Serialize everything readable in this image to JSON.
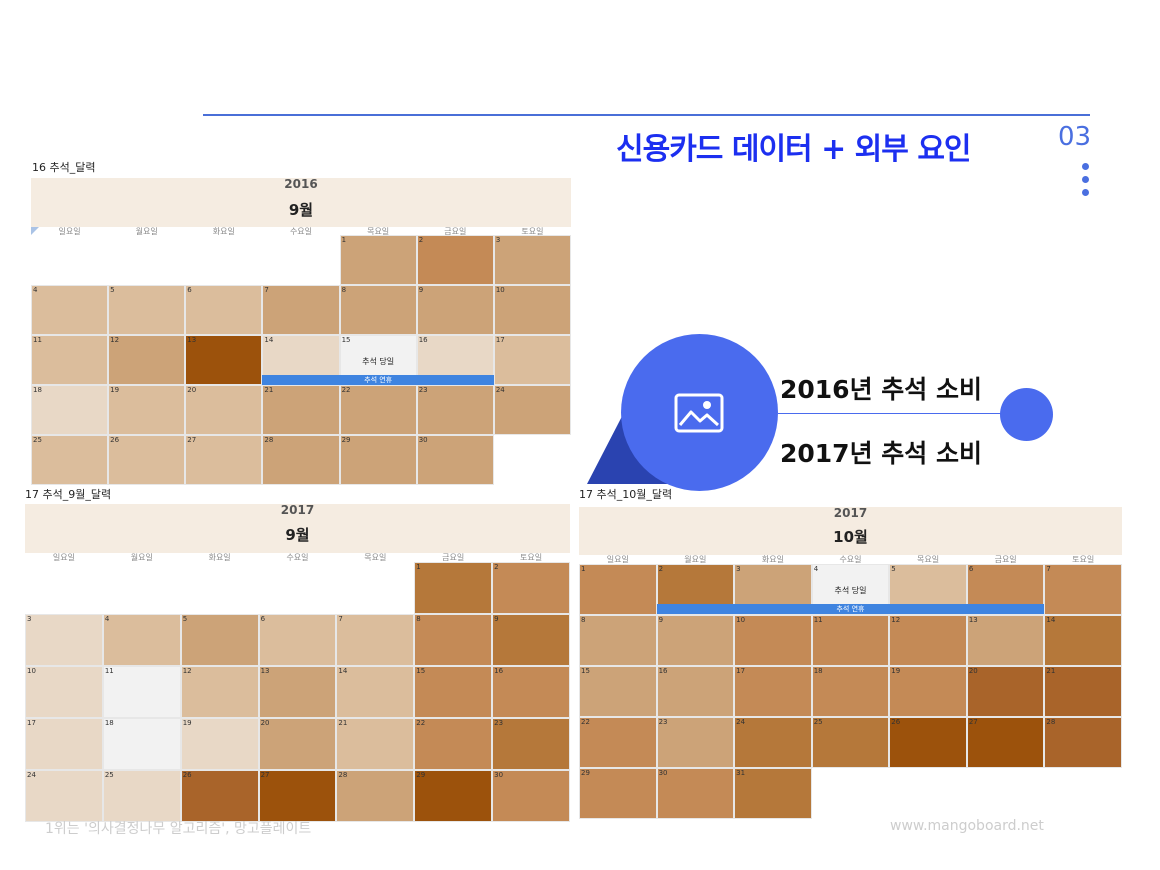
{
  "header": {
    "title": "신용카드 데이터 + 외부 요인",
    "page_number": "03"
  },
  "calendars": [
    {
      "caption": "16 추석_달력",
      "year": "2016",
      "month": "9월",
      "weekdays": [
        "일요일",
        "월요일",
        "화요일",
        "수요일",
        "목요일",
        "금요일",
        "토요일"
      ],
      "weeks": [
        [
          null,
          null,
          null,
          null,
          {
            "d": "1",
            "c": "#cca378"
          },
          {
            "d": "2",
            "c": "#c48a56"
          },
          {
            "d": "3",
            "c": "#cca378"
          }
        ],
        [
          {
            "d": "4",
            "c": "#dbbd9c"
          },
          {
            "d": "5",
            "c": "#dbbd9c"
          },
          {
            "d": "6",
            "c": "#dbbd9c"
          },
          {
            "d": "7",
            "c": "#cca378"
          },
          {
            "d": "8",
            "c": "#cca378"
          },
          {
            "d": "9",
            "c": "#cca378"
          },
          {
            "d": "10",
            "c": "#cca378"
          }
        ],
        [
          {
            "d": "11",
            "c": "#dbbd9c"
          },
          {
            "d": "12",
            "c": "#cca378"
          },
          {
            "d": "13",
            "c": "#9c520c"
          },
          {
            "d": "14",
            "c": "#e8d8c6"
          },
          {
            "d": "15",
            "c": "#f2f2f2",
            "text": "추석 당일"
          },
          {
            "d": "16",
            "c": "#e8d8c6"
          },
          {
            "d": "17",
            "c": "#dbbd9c"
          }
        ],
        [
          {
            "d": "18",
            "c": "#e8d8c6"
          },
          {
            "d": "19",
            "c": "#dbbd9c"
          },
          {
            "d": "20",
            "c": "#dbbd9c"
          },
          {
            "d": "21",
            "c": "#cca378"
          },
          {
            "d": "22",
            "c": "#cca378"
          },
          {
            "d": "23",
            "c": "#cca378"
          },
          {
            "d": "24",
            "c": "#cca378"
          }
        ],
        [
          {
            "d": "25",
            "c": "#dbbd9c"
          },
          {
            "d": "26",
            "c": "#dbbd9c"
          },
          {
            "d": "27",
            "c": "#dbbd9c"
          },
          {
            "d": "28",
            "c": "#cca378"
          },
          {
            "d": "29",
            "c": "#cca378"
          },
          {
            "d": "30",
            "c": "#cca378"
          },
          null
        ]
      ],
      "holiday_bar": {
        "label": "추석 연휴",
        "row": 2
      }
    },
    {
      "caption": "17 추석_9월_달력",
      "year": "2017",
      "month": "9월",
      "weekdays": [
        "일요일",
        "월요일",
        "화요일",
        "수요일",
        "목요일",
        "금요일",
        "토요일"
      ],
      "weeks": [
        [
          null,
          null,
          null,
          null,
          null,
          {
            "d": "1",
            "c": "#b5783a"
          },
          {
            "d": "2",
            "c": "#c48a56"
          }
        ],
        [
          {
            "d": "3",
            "c": "#e8d8c6"
          },
          {
            "d": "4",
            "c": "#dbbd9c"
          },
          {
            "d": "5",
            "c": "#cca378"
          },
          {
            "d": "6",
            "c": "#dbbd9c"
          },
          {
            "d": "7",
            "c": "#dbbd9c"
          },
          {
            "d": "8",
            "c": "#c48a56"
          },
          {
            "d": "9",
            "c": "#b5783a"
          }
        ],
        [
          {
            "d": "10",
            "c": "#e8d8c6"
          },
          {
            "d": "11",
            "c": "#f2f2f2"
          },
          {
            "d": "12",
            "c": "#dbbd9c"
          },
          {
            "d": "13",
            "c": "#cca378"
          },
          {
            "d": "14",
            "c": "#dbbd9c"
          },
          {
            "d": "15",
            "c": "#c48a56"
          },
          {
            "d": "16",
            "c": "#c48a56"
          }
        ],
        [
          {
            "d": "17",
            "c": "#e8d8c6"
          },
          {
            "d": "18",
            "c": "#f2f2f2"
          },
          {
            "d": "19",
            "c": "#e8d8c6"
          },
          {
            "d": "20",
            "c": "#cca378"
          },
          {
            "d": "21",
            "c": "#dbbd9c"
          },
          {
            "d": "22",
            "c": "#c48a56"
          },
          {
            "d": "23",
            "c": "#b5783a"
          }
        ],
        [
          {
            "d": "24",
            "c": "#e8d8c6"
          },
          {
            "d": "25",
            "c": "#e8d8c6"
          },
          {
            "d": "26",
            "c": "#a9642a"
          },
          {
            "d": "27",
            "c": "#9c520c"
          },
          {
            "d": "28",
            "c": "#cca378"
          },
          {
            "d": "29",
            "c": "#9c520c"
          },
          {
            "d": "30",
            "c": "#c48a56"
          }
        ]
      ],
      "holiday_bar": null
    },
    {
      "caption": "17 추석_10월_달력",
      "year": "2017",
      "month": "10월",
      "weekdays": [
        "일요일",
        "월요일",
        "화요일",
        "수요일",
        "목요일",
        "금요일",
        "토요일"
      ],
      "weeks": [
        [
          {
            "d": "1",
            "c": "#c48a56"
          },
          {
            "d": "2",
            "c": "#b5783a"
          },
          {
            "d": "3",
            "c": "#cca378"
          },
          {
            "d": "4",
            "c": "#f2f2f2",
            "text": "추석 당일"
          },
          {
            "d": "5",
            "c": "#dbbd9c"
          },
          {
            "d": "6",
            "c": "#c48a56"
          },
          {
            "d": "7",
            "c": "#c48a56"
          }
        ],
        [
          {
            "d": "8",
            "c": "#cca378"
          },
          {
            "d": "9",
            "c": "#cca378"
          },
          {
            "d": "10",
            "c": "#c48a56"
          },
          {
            "d": "11",
            "c": "#c48a56"
          },
          {
            "d": "12",
            "c": "#c48a56"
          },
          {
            "d": "13",
            "c": "#cca378"
          },
          {
            "d": "14",
            "c": "#b5783a"
          }
        ],
        [
          {
            "d": "15",
            "c": "#cca378"
          },
          {
            "d": "16",
            "c": "#cca378"
          },
          {
            "d": "17",
            "c": "#c48a56"
          },
          {
            "d": "18",
            "c": "#c48a56"
          },
          {
            "d": "19",
            "c": "#c48a56"
          },
          {
            "d": "20",
            "c": "#a9642a"
          },
          {
            "d": "21",
            "c": "#a9642a"
          }
        ],
        [
          {
            "d": "22",
            "c": "#c48a56"
          },
          {
            "d": "23",
            "c": "#cca378"
          },
          {
            "d": "24",
            "c": "#b5783a"
          },
          {
            "d": "25",
            "c": "#b5783a"
          },
          {
            "d": "26",
            "c": "#9c520c"
          },
          {
            "d": "27",
            "c": "#9c520c"
          },
          {
            "d": "28",
            "c": "#a9642a"
          }
        ],
        [
          {
            "d": "29",
            "c": "#c48a56"
          },
          {
            "d": "30",
            "c": "#c48a56"
          },
          {
            "d": "31",
            "c": "#b5783a"
          },
          null,
          null,
          null,
          null
        ]
      ],
      "holiday_bar": {
        "label": "추석 연휴",
        "row": 0
      }
    }
  ],
  "bubble": {
    "icon": "image-icon",
    "label_top": "2016년 추석 소비",
    "label_bottom": "2017년 추석 소비"
  },
  "footer": {
    "left": "1위는 '의사결정나무 알고리즘', 망고플레이트",
    "right": "www.mangoboard.net"
  },
  "colors": {
    "title": "#1c2ff0",
    "accent": "#4a6bee",
    "holiday_bar": "#3f84e0"
  }
}
